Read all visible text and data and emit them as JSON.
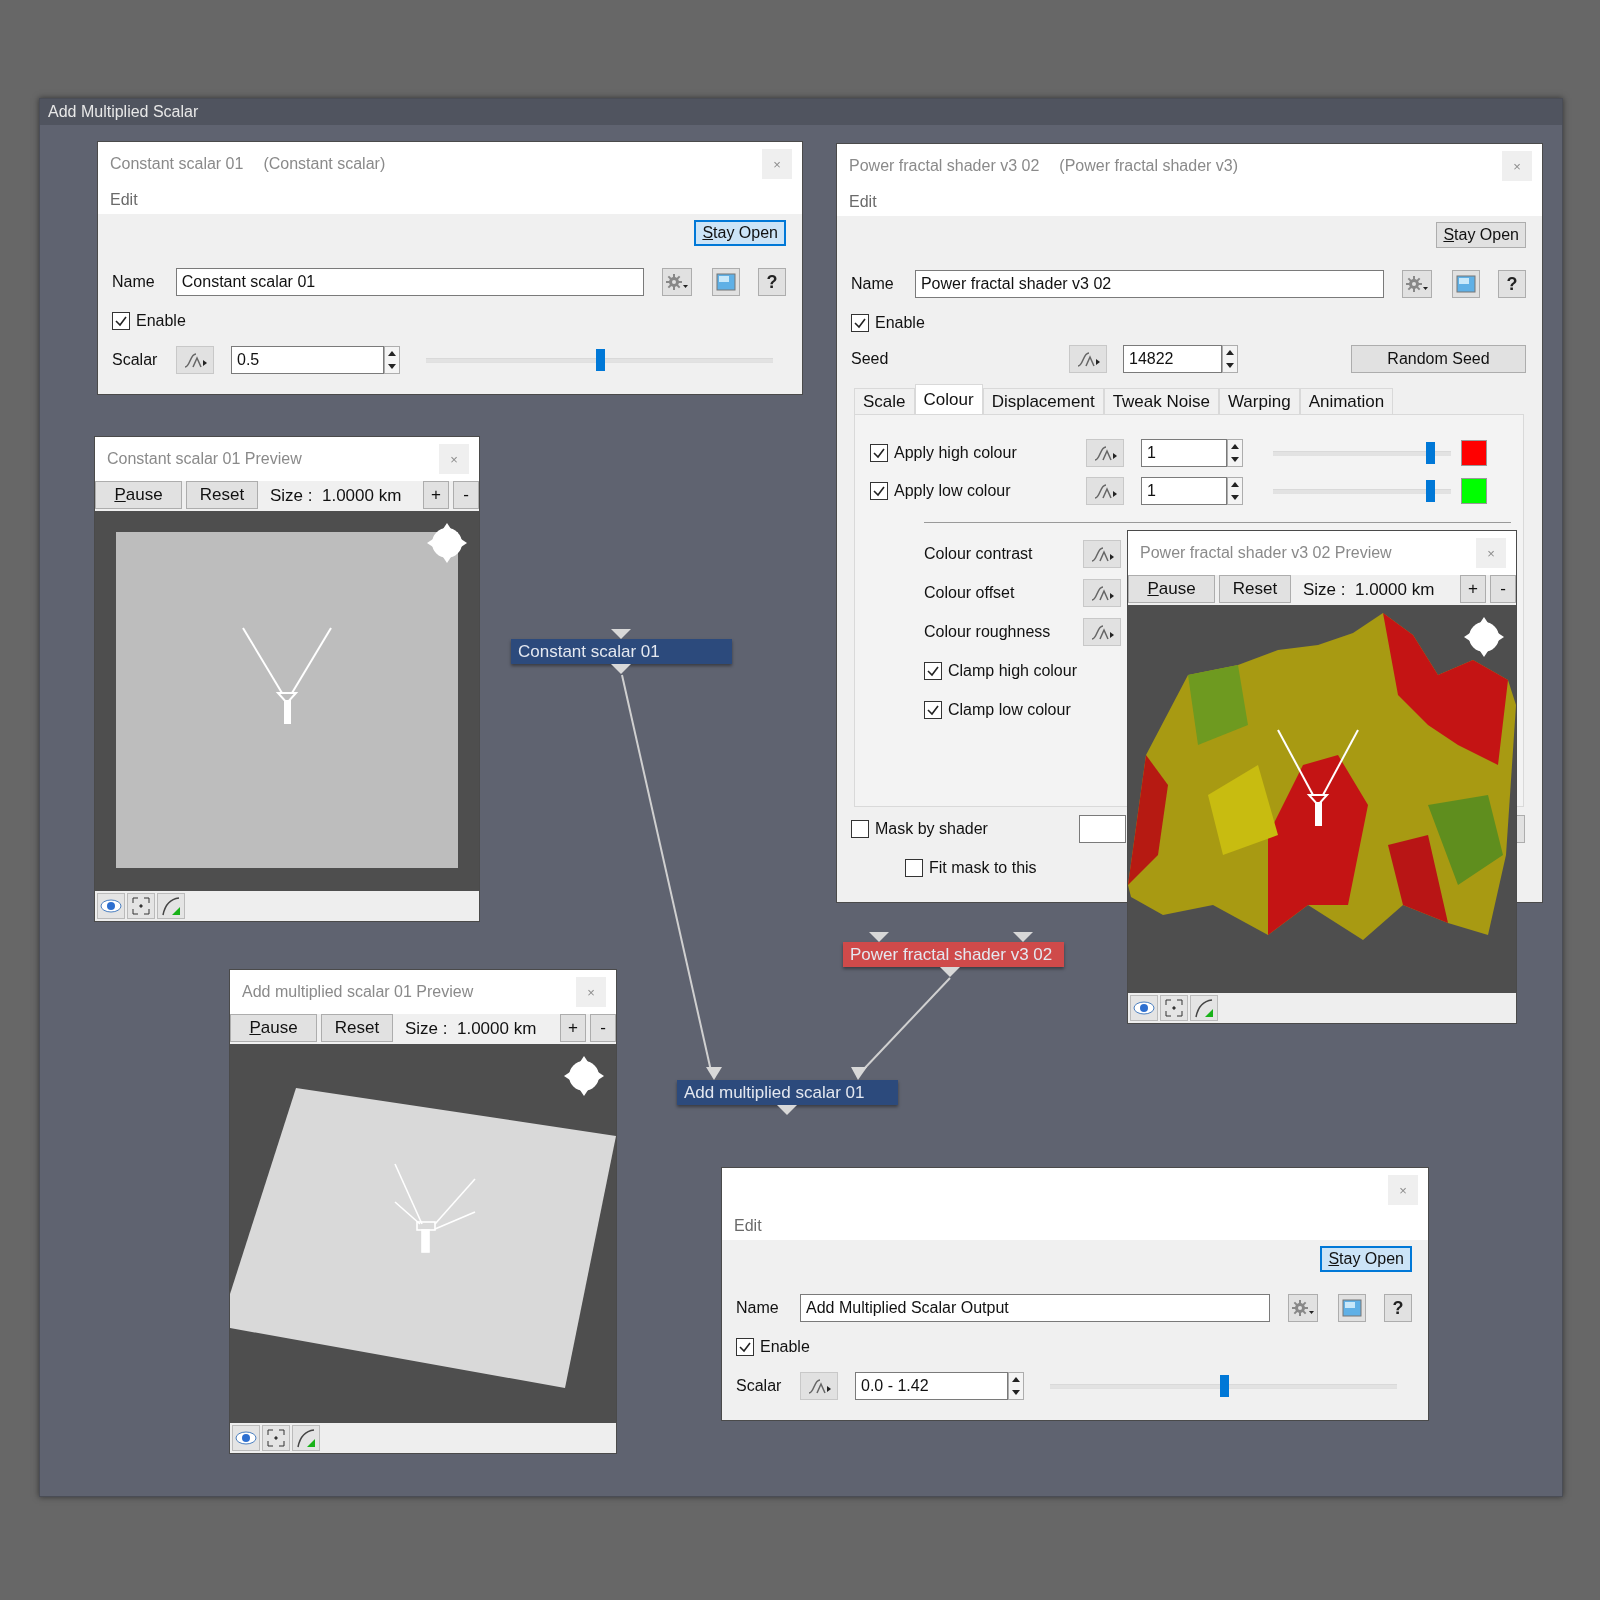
{
  "window": {
    "title": "Add Multiplied Scalar"
  },
  "dialogs": [
    {
      "kind": "scalar",
      "title": "Constant scalar 01",
      "subtitle": "(Constant scalar)",
      "close": "×",
      "menu": "Edit",
      "stay_open": {
        "label": "Stay Open",
        "focused": true
      },
      "name_label": "Name",
      "name_value": "Constant scalar 01",
      "help": "?",
      "enable": {
        "label": "Enable",
        "checked": true
      },
      "scalar": {
        "label": "Scalar",
        "value": "0.5",
        "level": 0.5
      }
    },
    {
      "kind": "shader",
      "title": "Power fractal shader v3 02",
      "subtitle": "(Power fractal shader v3)",
      "close": "×",
      "menu": "Edit",
      "stay_open": {
        "label": "Stay Open",
        "focused": false
      },
      "name_label": "Name",
      "name_value": "Power fractal shader v3 02",
      "help": "?",
      "enable": {
        "label": "Enable",
        "checked": true
      },
      "seed": {
        "label": "Seed",
        "value": "14822",
        "button": "Random Seed"
      },
      "tabs": [
        {
          "label": "Scale",
          "selected": false
        },
        {
          "label": "Colour",
          "selected": true
        },
        {
          "label": "Displacement",
          "selected": false
        },
        {
          "label": "Tweak Noise",
          "selected": false
        },
        {
          "label": "Warping",
          "selected": false
        },
        {
          "label": "Animation",
          "selected": false
        }
      ],
      "colour_rows": [
        {
          "label": "Apply high colour",
          "checked": true,
          "value": "1",
          "level": 0.88,
          "color": "#ff0000"
        },
        {
          "label": "Apply low colour",
          "checked": true,
          "value": "1",
          "level": 0.88,
          "color": "#00ff00"
        }
      ],
      "parameters": [
        {
          "label": "Colour contrast"
        },
        {
          "label": "Colour offset"
        },
        {
          "label": "Colour roughness"
        }
      ],
      "clamps": [
        {
          "label": "Clamp high colour",
          "checked": true
        },
        {
          "label": "Clamp low colour",
          "checked": true
        }
      ],
      "mask": {
        "label": "Mask by shader",
        "checked": false
      },
      "fit_mask": {
        "label": "Fit mask to this",
        "checked": false
      }
    },
    {
      "kind": "scalar",
      "close": "×",
      "menu": "Edit",
      "stay_open": {
        "label": "Stay Open",
        "focused": true
      },
      "name_label": "Name",
      "name_value": "Add Multiplied Scalar Output",
      "help": "?",
      "enable": {
        "label": "Enable",
        "checked": true
      },
      "scalar": {
        "label": "Scalar",
        "value": "0.0 - 1.42",
        "level": 0.5
      }
    }
  ],
  "previews": [
    {
      "title": "Constant scalar 01 Preview",
      "close": "×",
      "pause": "Pause",
      "reset": "Reset",
      "size": "Size :  1.0000 km",
      "zoom_in": "+",
      "zoom_out": "-"
    },
    {
      "title": "Add multiplied scalar 01 Preview",
      "close": "×",
      "pause": "Pause",
      "reset": "Reset",
      "size": "Size :  1.0000 km",
      "zoom_in": "+",
      "zoom_out": "-"
    },
    {
      "title": "Power fractal shader v3 02 Preview",
      "close": "×",
      "pause": "Pause",
      "reset": "Reset",
      "size": "Size :  1.0000 km",
      "zoom_in": "+",
      "zoom_out": "-"
    }
  ],
  "nodes": [
    {
      "label": "Constant scalar 01",
      "kind": "constant",
      "color": "#2c4a7c"
    },
    {
      "label": "Power fractal shader v3 02",
      "kind": "shader",
      "color": "#cf4a4a"
    },
    {
      "label": "Add multiplied scalar 01",
      "kind": "combiner",
      "color": "#2c4a7c"
    }
  ]
}
